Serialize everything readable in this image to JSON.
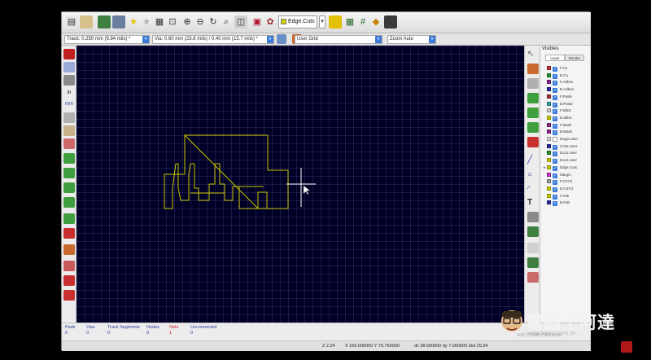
{
  "toolbar": {
    "layer_select": "Edge.Cuts",
    "buttons": [
      "new-board-icon",
      "open-icon",
      "save-icon",
      "page-settings-icon",
      "undo-icon",
      "redo-icon",
      "print-icon",
      "plot-icon",
      "zoom-in-icon",
      "zoom-out-icon",
      "zoom-redraw-icon",
      "zoom-fit-icon",
      "find-icon",
      "netlist-icon",
      "autoroute-icon",
      "layer-dropdown-icon",
      "layer-pair-icon",
      "drc-icon",
      "scripting-icon",
      "footprint-editor-icon"
    ]
  },
  "options": {
    "track": "Track: 0.250 mm (9.84 mils) *",
    "via": "Via: 0.60 mm (23.6 mils) / 0.40 mm (15.7 mils) *",
    "grid": "User Grid",
    "zoom": "Zoom Auto"
  },
  "visibles": {
    "title": "Visibles",
    "tabs": [
      "Layer",
      "Render"
    ],
    "layers": [
      {
        "name": "F.Cu",
        "color": "#c83232",
        "checked": true
      },
      {
        "name": "B.Cu",
        "color": "#2d8f2d",
        "checked": true
      },
      {
        "name": "F.Adhes",
        "color": "#8a2a8a",
        "checked": true
      },
      {
        "name": "B.Adhes",
        "color": "#2a2a9a",
        "checked": true
      },
      {
        "name": "F.Paste",
        "color": "#a53030",
        "checked": true
      },
      {
        "name": "B.Paste",
        "color": "#32a0a0",
        "checked": true
      },
      {
        "name": "F.SilkS",
        "color": "#c8c8c8",
        "checked": true
      },
      {
        "name": "B.SilkS",
        "color": "#c8c800",
        "checked": true
      },
      {
        "name": "F.Mask",
        "color": "#8a2a8a",
        "checked": true
      },
      {
        "name": "B.Mask",
        "color": "#8a2a8a",
        "checked": true
      },
      {
        "name": "Dwgs.User",
        "color": "#d8d8d8",
        "checked": false
      },
      {
        "name": "Cmts.User",
        "color": "#2a2a9a",
        "checked": true
      },
      {
        "name": "Eco1.User",
        "color": "#2d8f2d",
        "checked": true
      },
      {
        "name": "Eco2.User",
        "color": "#c8c800",
        "checked": true
      },
      {
        "name": "Edge.Cuts",
        "color": "#c8c800",
        "checked": true,
        "active": true
      },
      {
        "name": "Margin",
        "color": "#c832c8",
        "checked": true
      },
      {
        "name": "F.CrtYd",
        "color": "#9a9a9a",
        "checked": true
      },
      {
        "name": "B.CrtYd",
        "color": "#c8c800",
        "checked": true
      },
      {
        "name": "F.Fab",
        "color": "#c8c800",
        "checked": true
      },
      {
        "name": "B.Fab",
        "color": "#2a2a9a",
        "checked": true
      }
    ]
  },
  "messages": [
    {
      "label": "Pads",
      "value": "0",
      "color": "#2a3fa0"
    },
    {
      "label": "Vias",
      "value": "0",
      "color": "#2a3fa0"
    },
    {
      "label": "Track Segments",
      "value": "0",
      "color": "#2a3fa0"
    },
    {
      "label": "Nodes",
      "value": "0",
      "color": "#2a3fa0"
    },
    {
      "label": "Nets",
      "value": "1",
      "color": "#c82020"
    },
    {
      "label": "Unconnected",
      "value": "0",
      "color": "#2a3fa0"
    }
  ],
  "status": {
    "zoom": "Z 2.24",
    "xy": "X 165.000000  Y 76.750000",
    "dxdy": "dx 28.500000  dy 7.000000  dist 29.34"
  },
  "brand": {
    "text": "電腦王阿達",
    "url": "www.kocpc.com.tw",
    "sub": "KOC COMPUTER KING"
  },
  "colors": {
    "canvas_bg": "#000026",
    "edge_cuts": "#c8c400",
    "cursor": "#ffffff",
    "accent": "#3b7bdc"
  }
}
